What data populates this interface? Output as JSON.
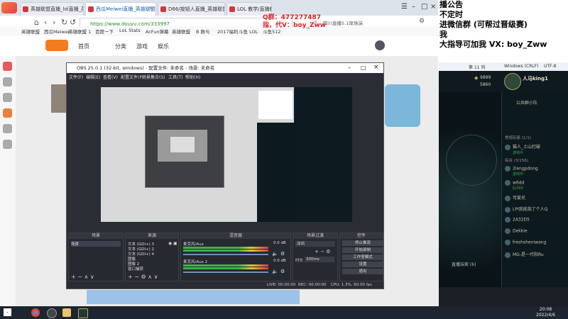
{
  "browser": {
    "tabs": [
      {
        "label": "英雄联盟直播_lol直播_英雄联盟",
        "active": false
      },
      {
        "label": "西瓜Meiwei直播_英雄联盟直播",
        "active": true
      },
      {
        "label": "D66/按钮人直播_英雄联盟直播",
        "active": false
      },
      {
        "label": "LOL 教学/直播教学",
        "active": false
      }
    ],
    "url": "https://www.douyu.com/333997",
    "search_hint": "四川直播5.1现场演",
    "bookmarks": [
      "英雄联盟",
      "西瓜Meiwei",
      "英雄联盟 1",
      "百度一下",
      "LoL Stats",
      "AcFun弹幕",
      "英雄联盟",
      "B 数与",
      "2017福利",
      "斗鱼 LOL",
      "斗鱼512"
    ],
    "site_nav": [
      "首页",
      "分类",
      "游戏",
      "娱乐"
    ]
  },
  "overlay": {
    "red_line1": "Q群：477277487",
    "red_line2": "指，代V：boy_Zww"
  },
  "announcement": {
    "lines": [
      "播公告",
      "不定时",
      "进微信群    (可帮过晋级赛)",
      "我",
      "大指导可加我 VX:  boy_Zww"
    ]
  },
  "obs": {
    "title": "OBS 25.0.1 (32-bit, windows) - 配置文件: 未命名 - 场景: 未命名",
    "menu": [
      "文件(F)",
      "编辑(E)",
      "查看(V)",
      "配置文件(P)",
      "场景集合(S)",
      "工具(T)",
      "帮助(H)"
    ],
    "docks": {
      "scenes": {
        "header": "场景",
        "items": [
          "场景"
        ]
      },
      "sources": {
        "header": "来源",
        "items": [
          "文本 (GDI+) 3",
          "文本 (GDI+) 2",
          "文本 (GDI+) 4",
          "图像",
          "图像 2",
          "窗口捕获"
        ]
      },
      "mixer": {
        "header": "混音器",
        "tracks": [
          {
            "name": "麦克风/Aux",
            "db": "0.0 dB"
          },
          {
            "name": "麦克风/Aux 2",
            "db": "0.0 dB"
          }
        ]
      },
      "transitions": {
        "header": "场景过渡",
        "type": "淡出",
        "duration_label": "时长",
        "duration": "300ms"
      },
      "controls": {
        "header": "控件",
        "buttons": [
          "停止推流",
          "开始录制",
          "工作室模式",
          "设置",
          "退出"
        ]
      }
    },
    "status": {
      "live": "LIVE: 00:00:00",
      "rec": "REC: 00:00:00",
      "cpu": "CPU: 1.3%, 60.00 fps"
    }
  },
  "winstat": {
    "zoom": "第 11 列",
    "platform": "Windows (CRLF)",
    "encoding": "UTF-8"
  },
  "lol": {
    "blue_essence": "9899",
    "riot_points": "5860",
    "profile_name": "人马king1",
    "group_header": "公共群小队",
    "friends_header": "常规玩家 (1/1)",
    "general_header": "综合 (3/156)",
    "friends": [
      {
        "name": "猫人_土山打破",
        "status": "游戏中"
      },
      {
        "name": "2lengpdong",
        "status": "游戏中"
      },
      {
        "name": "w6dd",
        "status": "队列中"
      },
      {
        "name": "可爱兄",
        "status": ""
      },
      {
        "name": "LPI我能指了个人Q",
        "status": ""
      },
      {
        "name": "2A32D5",
        "status": ""
      },
      {
        "name": "Dekkie",
        "status": ""
      },
      {
        "name": "freshsheniwang",
        "status": ""
      },
      {
        "name": "MG-是一代阳Ru",
        "status": ""
      }
    ],
    "online_players": "直播玩家 (6)"
  },
  "taskbar": {
    "time": "20:08",
    "date": "2022/4/6"
  }
}
